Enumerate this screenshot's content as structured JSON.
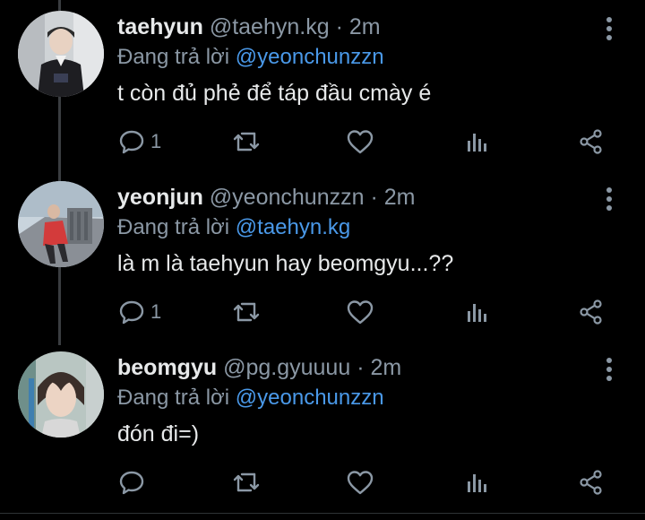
{
  "colors": {
    "background": "#000000",
    "text_primary": "#e7e9ea",
    "text_secondary": "#8b98a5",
    "mention": "#4a99e9"
  },
  "tweets": [
    {
      "display_name": "taehyun",
      "handle": "@taehyn.kg",
      "separator": "·",
      "time": "2m",
      "reply_prefix": "Đang trả lời",
      "reply_to": "@yeonchunzzn",
      "text": "t còn đủ phẻ để táp đầu cmày é",
      "reply_count": "1",
      "icons": [
        "reply-icon",
        "retweet-icon",
        "like-icon",
        "views-icon",
        "share-icon",
        "more-icon"
      ]
    },
    {
      "display_name": "yeonjun",
      "handle": "@yeonchunzzn",
      "separator": "·",
      "time": "2m",
      "reply_prefix": "Đang trả lời",
      "reply_to": "@taehyn.kg",
      "text": "là m là taehyun hay beomgyu...??",
      "reply_count": "1",
      "icons": [
        "reply-icon",
        "retweet-icon",
        "like-icon",
        "views-icon",
        "share-icon",
        "more-icon"
      ]
    },
    {
      "display_name": "beomgyu",
      "handle": "@pg.gyuuuu",
      "separator": "·",
      "time": "2m",
      "reply_prefix": "Đang trả lời",
      "reply_to": "@yeonchunzzn",
      "text": "đón đi=)",
      "reply_count": "",
      "icons": [
        "reply-icon",
        "retweet-icon",
        "like-icon",
        "views-icon",
        "share-icon",
        "more-icon"
      ]
    }
  ]
}
